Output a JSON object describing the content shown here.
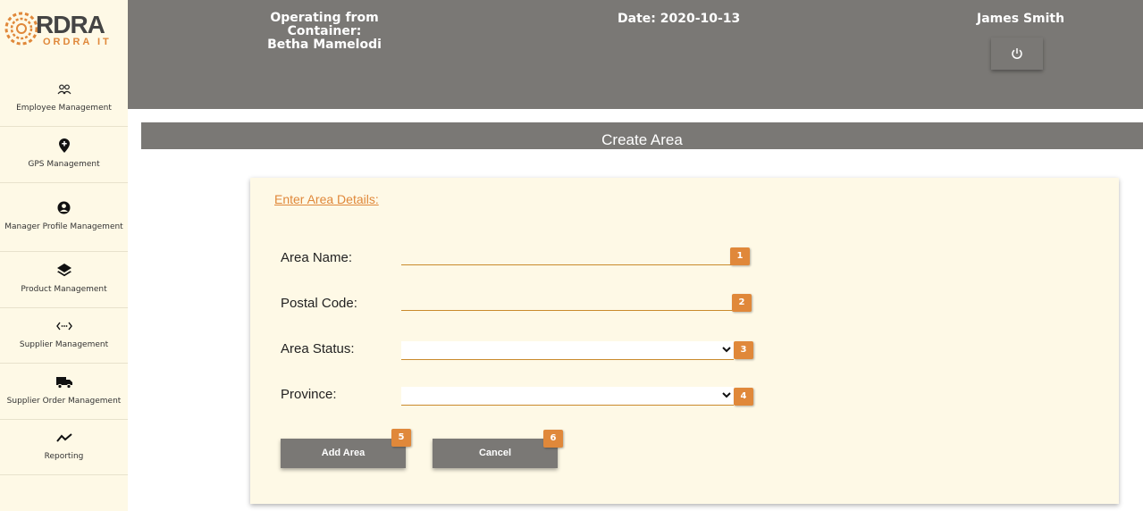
{
  "brand": {
    "name": "RDRA",
    "tagline": "ORDRA IT",
    "accent": "#e0883a"
  },
  "sidebar": {
    "items": [
      {
        "label": "Employee Management",
        "icon": "people-icon"
      },
      {
        "label": "GPS Management",
        "icon": "map-pin-icon"
      },
      {
        "label": "Manager Profile Management",
        "icon": "user-circle-icon"
      },
      {
        "label": "Product Management",
        "icon": "layers-icon"
      },
      {
        "label": "Supplier Management",
        "icon": "arrows-left-right-icon"
      },
      {
        "label": "Supplier Order Management",
        "icon": "truck-icon"
      },
      {
        "label": "Reporting",
        "icon": "trend-line-icon"
      }
    ]
  },
  "header": {
    "container_label": "Operating from Container:",
    "container_name": "Betha Mamelodi",
    "date": "Date: 2020-10-13",
    "user": "James Smith",
    "logout_icon": "power-icon",
    "background": "#7a7875"
  },
  "page": {
    "title": "Create Area"
  },
  "form": {
    "title": "Enter Area Details:",
    "area_name": {
      "label": "Area Name:",
      "value": "",
      "badge": "1"
    },
    "postal_code": {
      "label": "Postal Code:",
      "value": "",
      "badge": "2"
    },
    "area_status": {
      "label": "Area Status:",
      "value": "",
      "badge": "3"
    },
    "province": {
      "label": "Province:",
      "value": "",
      "badge": "4"
    },
    "add_button": {
      "label": "Add Area",
      "badge": "5"
    },
    "cancel_button": {
      "label": "Cancel",
      "badge": "6"
    }
  }
}
